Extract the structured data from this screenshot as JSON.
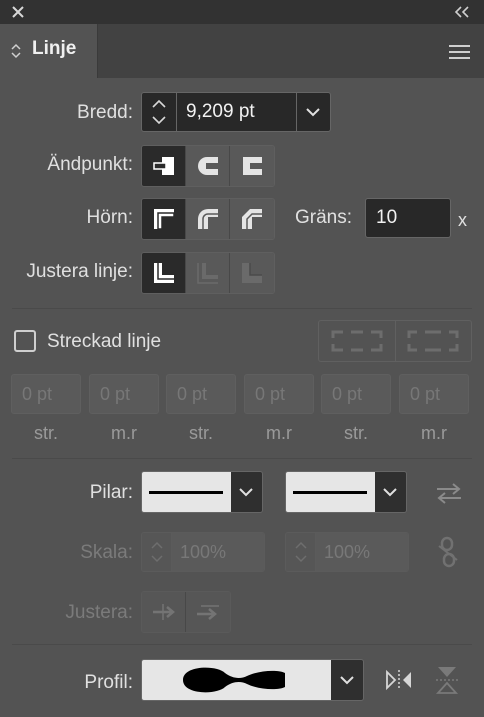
{
  "panel": {
    "tab_title": "Linje"
  },
  "stroke": {
    "weight_label": "Bredd:",
    "weight_value": "9,209 pt",
    "cap_label": "Ändpunkt:",
    "corner_label": "Hörn:",
    "limit_label": "Gräns:",
    "limit_value": "10",
    "limit_unit": "x",
    "align_label": "Justera linje:"
  },
  "dashed": {
    "checkbox_label": "Streckad linje",
    "checked": false,
    "fields": [
      {
        "value": "0 pt",
        "label": "str."
      },
      {
        "value": "0 pt",
        "label": "m.r"
      },
      {
        "value": "0 pt",
        "label": "str."
      },
      {
        "value": "0 pt",
        "label": "m.r"
      },
      {
        "value": "0 pt",
        "label": "str."
      },
      {
        "value": "0 pt",
        "label": "m.r"
      }
    ]
  },
  "arrows": {
    "label": "Pilar:",
    "scale_label": "Skala:",
    "scale_start": "100%",
    "scale_end": "100%",
    "align_label": "Justera:"
  },
  "profile": {
    "label": "Profil:"
  },
  "colors": {
    "panel_bg": "#535353",
    "titlebar_bg": "#323232",
    "field_bg": "#282828",
    "selected_button": "#2a2a2a",
    "text": "#e0e0e0",
    "disabled_text": "#7b7b7b"
  },
  "icons": [
    "close-icon",
    "collapse-panel-icon",
    "updown-arrows-icon",
    "panel-menu-icon",
    "chevron-down-icon",
    "butt-cap-icon",
    "round-cap-icon",
    "square-cap-icon",
    "miter-join-icon",
    "round-join-icon",
    "bevel-join-icon",
    "align-center-icon",
    "align-inside-icon",
    "align-outside-icon",
    "dash-exact-icon",
    "dash-adjust-icon",
    "swap-arrows-icon",
    "link-broken-icon",
    "arrow-tip-beyond-icon",
    "arrow-tip-at-end-icon",
    "flip-horizontal-icon",
    "flip-vertical-icon"
  ]
}
